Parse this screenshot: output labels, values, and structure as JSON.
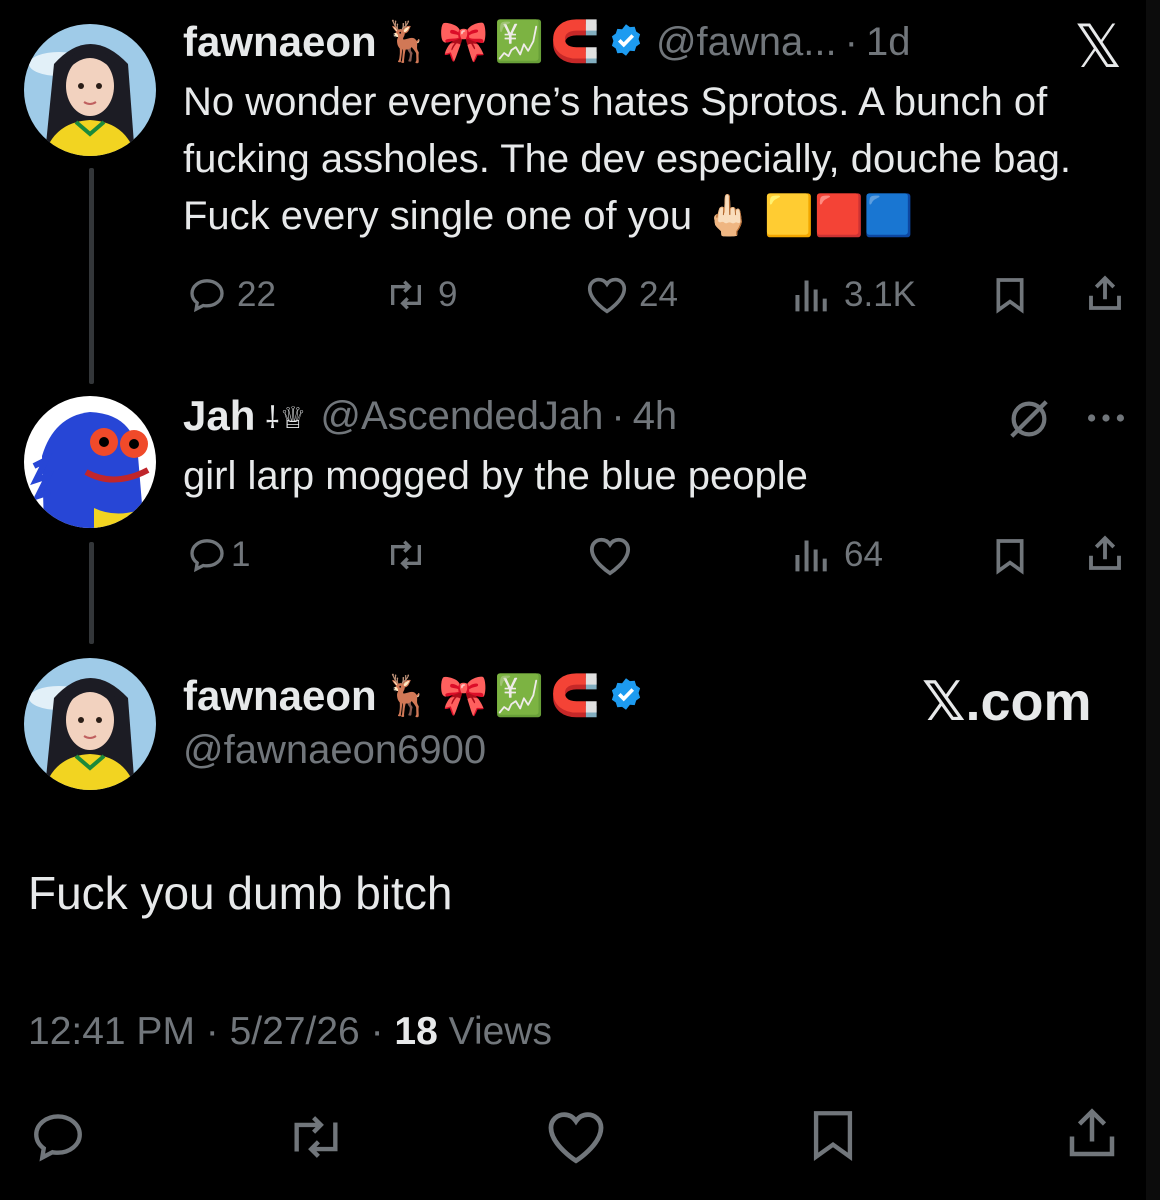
{
  "tweet1": {
    "display_name": "fawnaeon",
    "emojis": [
      "🦌",
      "🎀",
      "💹",
      "🧲"
    ],
    "handle": "@fawna...",
    "time": "1d",
    "text": "No wonder everyone’s hates Sprotos. A bunch of fucking assholes. The dev especially, douche bag. Fuck every single one of you",
    "text_emojis": [
      "🖕🏻",
      "🟨",
      "🟥",
      "🟦"
    ],
    "replies": "22",
    "reposts": "9",
    "likes": "24",
    "views": "3.1K",
    "brand_glyph": "𝕏"
  },
  "tweet2": {
    "display_name": "Jah",
    "name_symbols": "⸸♕",
    "handle": "@AscendedJah",
    "time": "4h",
    "text": "girl larp mogged by the blue people",
    "replies": "1",
    "views": "64"
  },
  "tweet3": {
    "display_name": "fawnaeon",
    "emojis": [
      "🦌",
      "🎀",
      "💹",
      "🧲"
    ],
    "handle": "@fawnaeon6900",
    "brand": "𝕏.com",
    "text": "Fuck you dumb bitch",
    "time": "12:41 PM",
    "date": "5/27/26",
    "views_count": "18",
    "views_label": "Views"
  },
  "colors": {
    "background": "#000000",
    "text": "#e7e9ea",
    "muted": "#71767b",
    "verified": "#1d9bf0",
    "thread_line": "#333639"
  }
}
